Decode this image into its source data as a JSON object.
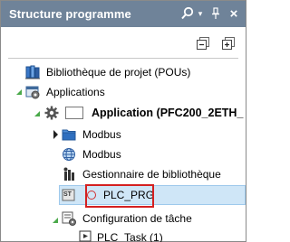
{
  "window": {
    "title": "Structure programme",
    "title_bar_color": "#6f8399",
    "buttons": {
      "search_icon": "search-icon",
      "dropdown_icon": "chevron-down-icon",
      "pin_icon": "pin-icon",
      "close_glyph": "×"
    }
  },
  "toolbar": {
    "icons": [
      "collapse-all-icon",
      "expand-all-icon"
    ]
  },
  "tree": {
    "pou_library": "Bibliothèque de projet (POUs)",
    "applications": "Applications",
    "application": "Application (PFC200_2ETH_",
    "modbus_folder": "Modbus",
    "modbus": "Modbus",
    "library_manager": "Gestionnaire de bibliothèque",
    "plc_prg": "PLC_PRG",
    "task_config": "Configuration de tâche",
    "plc_task": "PLC_Task (1)"
  },
  "selection": {
    "selected_item": "PLC_PRG",
    "highlight_color": "#cfe6f7",
    "annotation_color": "#d42020"
  }
}
